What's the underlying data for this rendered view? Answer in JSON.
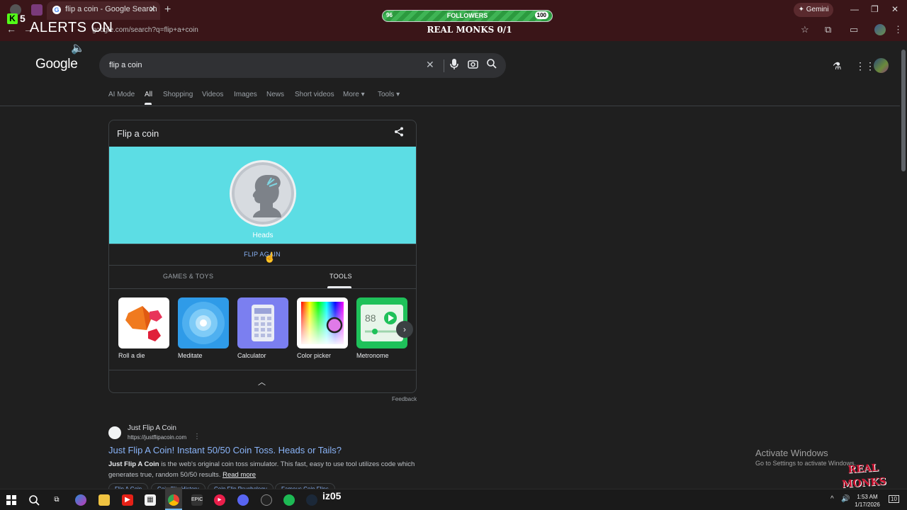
{
  "browser": {
    "tab_title": "flip a coin - Google Search",
    "tab_favicon": "G",
    "new_tab": "+",
    "url_visible": "google.com/search?q=flip+a+coin",
    "gemini_label": "Gemini",
    "back_icon": "←",
    "forward_icon": "→",
    "minimize": "—",
    "restore": "❐",
    "close": "✕",
    "tab_close": "✕"
  },
  "overlay": {
    "kick_badge": "K",
    "kick_count": "5",
    "alerts": "ALERTS ON",
    "followers_label": "FOLLOWERS",
    "followers_current": "96",
    "followers_goal": "100",
    "followers_progress": 0.96,
    "real_monks": "REAL MONKS 0/1",
    "streamer_name": "iz05",
    "logo_text_1": "REAL",
    "logo_text_2": "MONKS"
  },
  "google": {
    "logo": "Google",
    "query": "flip a coin",
    "tabs": [
      {
        "label": "AI Mode",
        "active": false
      },
      {
        "label": "All",
        "active": true
      },
      {
        "label": "Shopping",
        "active": false
      },
      {
        "label": "Videos",
        "active": false
      },
      {
        "label": "Images",
        "active": false
      },
      {
        "label": "News",
        "active": false
      },
      {
        "label": "Short videos",
        "active": false
      },
      {
        "label": "More",
        "active": false
      },
      {
        "label": "Tools",
        "active": false
      }
    ]
  },
  "coin_card": {
    "title": "Flip a coin",
    "result": "Heads",
    "flip_again": "FLIP AGAIN",
    "categories": [
      {
        "label": "GAMES & TOYS",
        "active": false
      },
      {
        "label": "TOOLS",
        "active": true
      }
    ],
    "tools": [
      {
        "label": "Roll a die",
        "color": "#ffffff"
      },
      {
        "label": "Meditate",
        "color": "#2f9be8"
      },
      {
        "label": "Calculator",
        "color": "#7b7ff0"
      },
      {
        "label": "Color picker",
        "color": "#ffffff"
      },
      {
        "label": "Metronome",
        "color": "#1fc15a"
      }
    ],
    "metronome_bpm": "88",
    "feedback": "Feedback"
  },
  "result": {
    "site_name": "Just Flip A Coin",
    "url": "https://justflipacoin.com",
    "title": "Just Flip A Coin! Instant 50/50 Coin Toss. Heads or Tails?",
    "snippet_bold": "Just Flip A Coin",
    "snippet_rest": " is the web's original coin toss simulator. This fast, easy to use tool utilizes code which generates true, random 50/50 results. ",
    "read_more": "Read more",
    "chips": [
      "Flip A Coin",
      "Coin Flip History",
      "Coin Flip Psychology",
      "Famous Coin Flips"
    ]
  },
  "windows": {
    "activate_title": "Activate Windows",
    "activate_sub": "Go to Settings to activate Windows.",
    "time": "1:53 AM",
    "date": "1/17/2026",
    "notif_count": "10"
  }
}
